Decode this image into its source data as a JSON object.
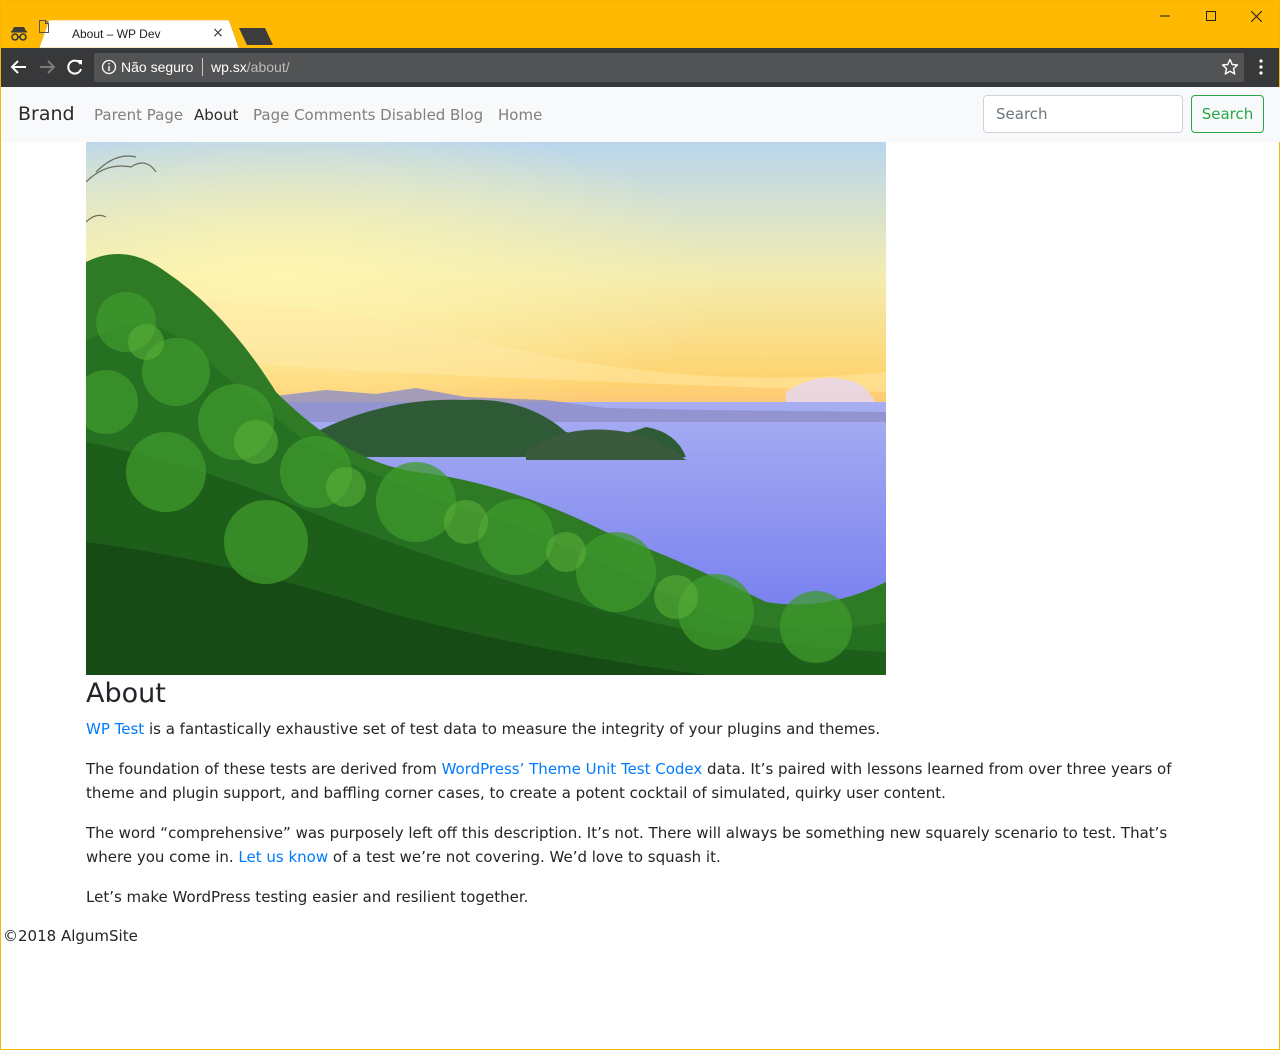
{
  "browser": {
    "tab_title": "About – WP Dev",
    "tab_close": "×",
    "security_label": "Não seguro",
    "url_host": "wp.sx",
    "url_path": "/about/"
  },
  "navbar": {
    "brand": "Brand",
    "items": [
      {
        "label": "Parent Page",
        "active": false
      },
      {
        "label": "About",
        "active": true
      },
      {
        "label": "Page Comments Disabled",
        "active": false
      },
      {
        "label": "Blog",
        "active": false
      },
      {
        "label": "Home",
        "active": false
      }
    ],
    "search_placeholder": "Search",
    "search_button": "Search"
  },
  "hero": {
    "icon": "landscape-photo-sunset-coast"
  },
  "content": {
    "title": "About",
    "p1_link": "WP Test",
    "p1_rest": " is a fantastically exhaustive set of test data to measure the integrity of your plugins and themes.",
    "p2_start": "The foundation of these tests are derived from ",
    "p2_link": "WordPress’ Theme Unit Test Codex",
    "p2_rest": " data. It’s paired with lessons learned from over three years of theme and plugin support, and baffling corner cases, to create a potent cocktail of simulated, quirky user content.",
    "p3_start": "The word “comprehensive” was purposely left off this description. It’s not. There will always be something new squarely scenario to test. That’s where you come in. ",
    "p3_link": "Let us know",
    "p3_rest": " of a test we’re not covering. We’d love to squash it.",
    "p4": "Let’s make WordPress testing easier and resilient together."
  },
  "footer": {
    "text": "©2018 AlgumSite"
  },
  "colors": {
    "titlebar": "#ffb900",
    "toolbar": "#37383a",
    "link": "#007bff",
    "success": "#28a745"
  }
}
